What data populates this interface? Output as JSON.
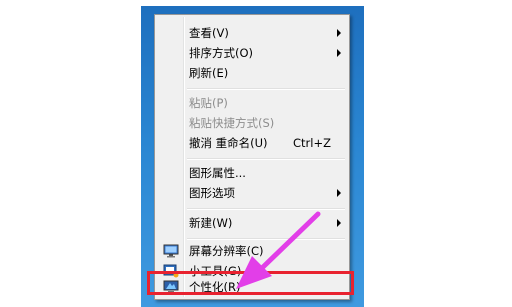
{
  "context_menu": {
    "view": "查看(V)",
    "sort": "排序方式(O)",
    "refresh": "刷新(E)",
    "paste": "粘贴(P)",
    "paste_shortcut": "粘贴快捷方式(S)",
    "undo_rename": "撤消 重命名(U)",
    "undo_shortcut": "Ctrl+Z",
    "graphics_properties": "图形属性...",
    "graphics_options": "图形选项",
    "new": "新建(W)",
    "screen_resolution": "屏幕分辨率(C)",
    "gadgets": "小工具(G)",
    "personalize": "个性化(R)"
  },
  "icons": {
    "screen_resolution": "monitor-icon",
    "gadgets": "gadget-icon",
    "personalize": "personalize-icon"
  },
  "colors": {
    "annotation_arrow": "#e23ee8",
    "annotation_box": "#e8222f",
    "desktop_blue": "#2a86d2"
  }
}
